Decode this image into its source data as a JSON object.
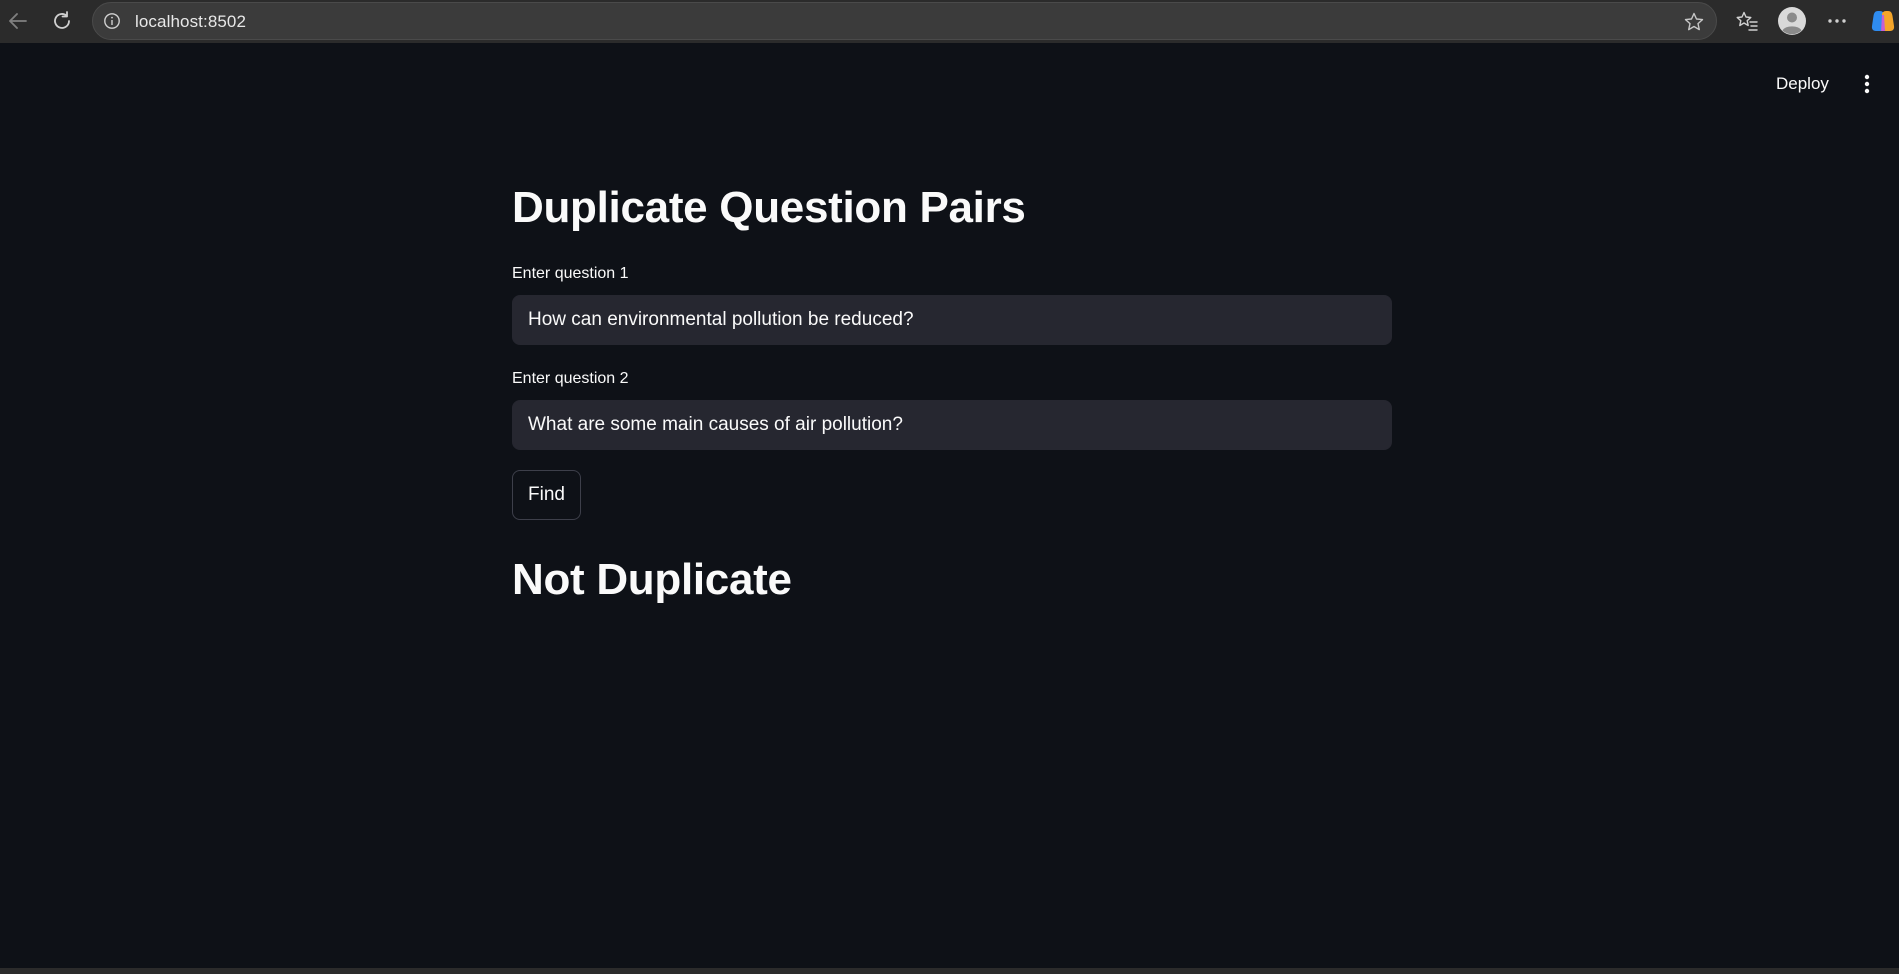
{
  "browser": {
    "url": "localhost:8502",
    "icons": {
      "back": "arrow-left-icon",
      "reload": "reload-icon",
      "site_info": "info-icon",
      "favorite": "star-icon",
      "favorites_list": "favorites-icon",
      "profile": "profile-icon",
      "more": "more-horizontal-icon",
      "copilot": "copilot-icon"
    }
  },
  "header": {
    "deploy_label": "Deploy",
    "menu_icon": "more-vertical-icon"
  },
  "main": {
    "title": "Duplicate Question Pairs",
    "question1": {
      "label": "Enter question 1",
      "value": "How can environmental pollution be reduced?"
    },
    "question2": {
      "label": "Enter question 2",
      "value": "What are some main causes of air pollution?"
    },
    "find_label": "Find",
    "result": "Not Duplicate"
  },
  "colors": {
    "app_background": "#0e1117",
    "input_background": "#262730",
    "text": "#fafafa",
    "browser_chrome": "#2b2b2b"
  }
}
